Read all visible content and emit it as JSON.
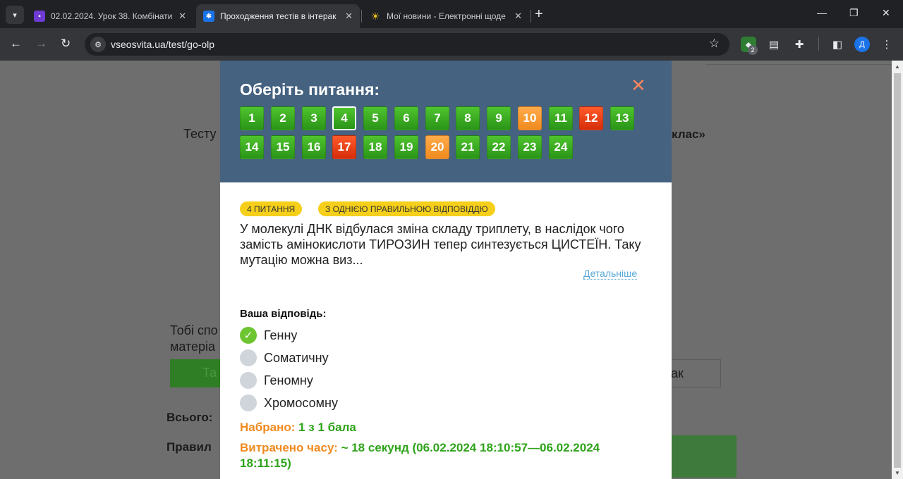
{
  "browser": {
    "tabs": [
      {
        "title": "02.02.2024. Урок 38. Комбінати",
        "favicon_color": "#6d3bd1",
        "active": false
      },
      {
        "title": "Проходження тестів в інтерак",
        "favicon_color": "#1a73e8",
        "active": true
      },
      {
        "title": "Мої новини - Електронні щоде",
        "favicon_color": "#f5c518",
        "active": false
      }
    ],
    "new_tab_label": "+",
    "url": "vseosvita.ua/test/go-olp",
    "extension_badge": "2",
    "profile_initial": "Д"
  },
  "background": {
    "heading_start": "Тесту",
    "heading_end": "клас»",
    "para_line1": "Тобі спо",
    "para_line2": "матеріа",
    "btn_left": "Та",
    "btn_right": "ак",
    "total_label": "Всього:",
    "correct_label": "Правил"
  },
  "modal": {
    "title": "Оберіть питання:",
    "close_symbol": "✕",
    "questions": [
      {
        "n": "1",
        "status": "green"
      },
      {
        "n": "2",
        "status": "green"
      },
      {
        "n": "3",
        "status": "green"
      },
      {
        "n": "4",
        "status": "green",
        "current": true
      },
      {
        "n": "5",
        "status": "green"
      },
      {
        "n": "6",
        "status": "green"
      },
      {
        "n": "7",
        "status": "green"
      },
      {
        "n": "8",
        "status": "green"
      },
      {
        "n": "9",
        "status": "green"
      },
      {
        "n": "10",
        "status": "orange"
      },
      {
        "n": "11",
        "status": "green"
      },
      {
        "n": "12",
        "status": "red"
      },
      {
        "n": "13",
        "status": "green"
      },
      {
        "n": "14",
        "status": "green"
      },
      {
        "n": "15",
        "status": "green"
      },
      {
        "n": "16",
        "status": "green"
      },
      {
        "n": "17",
        "status": "red"
      },
      {
        "n": "18",
        "status": "green"
      },
      {
        "n": "19",
        "status": "green"
      },
      {
        "n": "20",
        "status": "orange"
      },
      {
        "n": "21",
        "status": "green"
      },
      {
        "n": "22",
        "status": "green"
      },
      {
        "n": "23",
        "status": "green"
      },
      {
        "n": "24",
        "status": "green"
      }
    ],
    "tag_question": "4 ПИТАННЯ",
    "tag_type": "З ОДНІЄЮ ПРАВИЛЬНОЮ ВІДПОВІДДЮ",
    "question_text": "У молекулі ДНК відбулася зміна складу триплету, в наслідок чого замість амінокислоти ТИРОЗИН тепер синтезується ЦИСТЕЇН. Таку мутацію можна виз...",
    "more_link": "Детальніше",
    "your_answer_label": "Ваша відповідь:",
    "options": [
      {
        "label": "Генну",
        "selected": true
      },
      {
        "label": "Соматичну",
        "selected": false
      },
      {
        "label": "Геномну",
        "selected": false
      },
      {
        "label": "Хромосомну",
        "selected": false
      }
    ],
    "score_label": "Набрано:",
    "score_value": "1 з 1 бала",
    "time_label": "Витрачено часу:",
    "time_value": "~ 18 секунд (06.02.2024 18:10:57—06.02.2024 18:11:15)"
  },
  "colors": {
    "header_bg": "#456280",
    "correct": "#2ea319",
    "partial": "#f08a1e",
    "wrong": "#d62d0a",
    "tag": "#f5cf1a"
  }
}
